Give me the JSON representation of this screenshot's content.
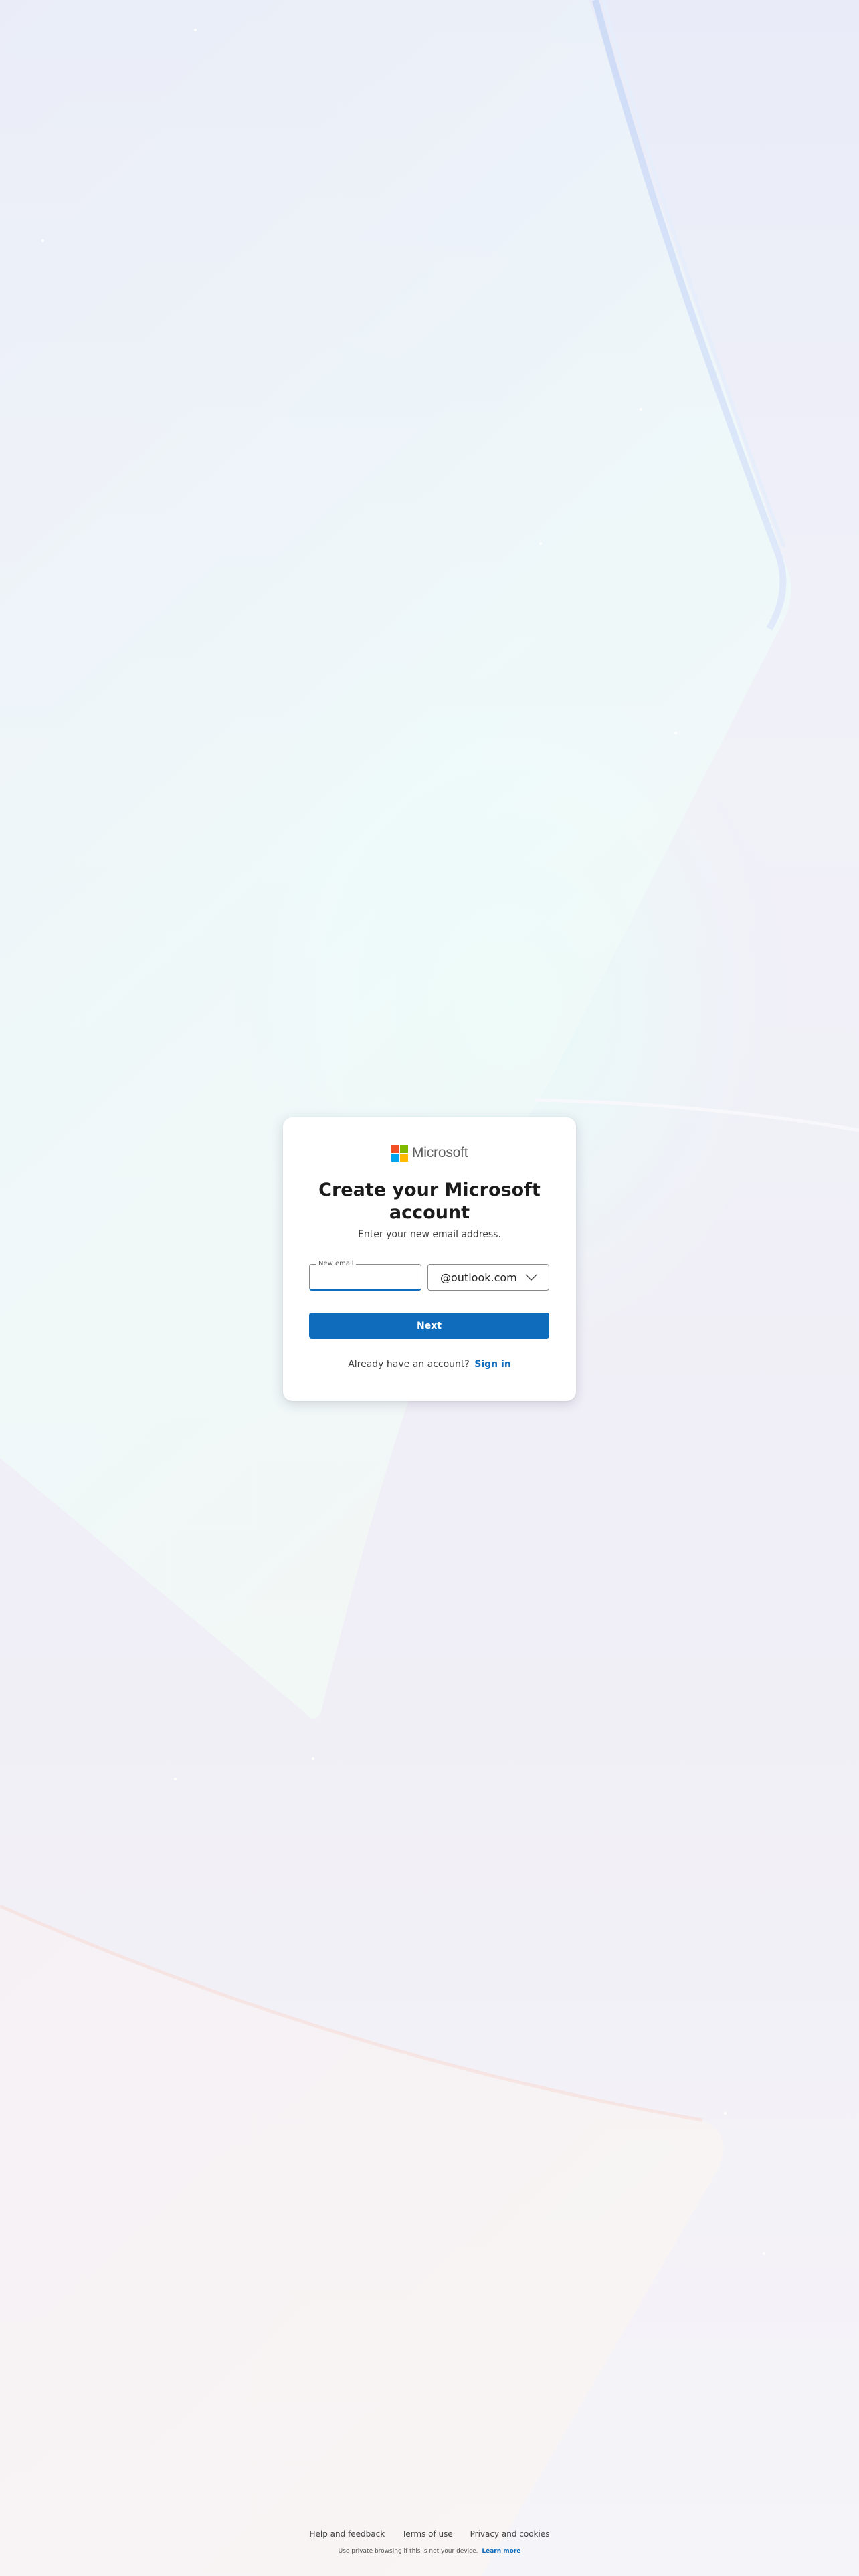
{
  "brand": {
    "name": "Microsoft",
    "colors": {
      "red": "#f25022",
      "green": "#7fba00",
      "blue": "#00a4ef",
      "yellow": "#ffb900"
    }
  },
  "card": {
    "title": "Create your Microsoft account",
    "subtitle": "Enter your new email address.",
    "email_field": {
      "label": "New email",
      "value": ""
    },
    "domain_select": {
      "selected": "@outlook.com"
    },
    "next_label": "Next",
    "signin_prompt": "Already have an account?",
    "signin_link": "Sign in"
  },
  "footer": {
    "links": [
      "Help and feedback",
      "Terms of use",
      "Privacy and cookies"
    ],
    "note": "Use private browsing if this is not your device.",
    "note_link": "Learn more"
  },
  "theme": {
    "accent": "#0f6cbd",
    "background": "#f4f3f7"
  }
}
